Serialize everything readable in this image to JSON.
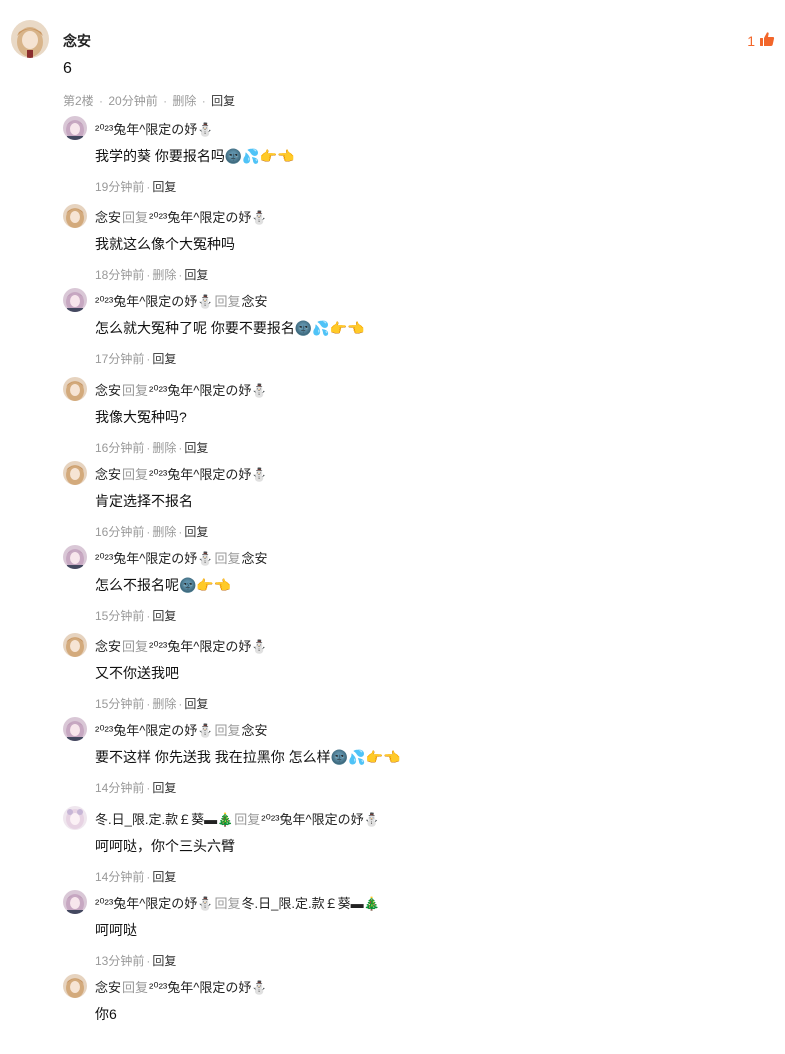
{
  "main_comment": {
    "author": "念安",
    "content": "6",
    "floor": "第2楼",
    "time": "20分钟前",
    "delete_label": "删除",
    "reply_label": "回复",
    "like_count": "1",
    "like_icon": "thumbs-up-icon"
  },
  "reply_word": "回复",
  "delete_word": "删除",
  "sep": "·",
  "replies": [
    {
      "author": "²⁰²³兔年^限定の妤⛄",
      "to": "",
      "text": "我学的葵 你要报名吗🌚💦👉👈",
      "time": "19分钟前",
      "can_delete": false
    },
    {
      "author": "念安",
      "to": "²⁰²³兔年^限定の妤⛄",
      "text": "我就这么像个大冤种吗",
      "time": "18分钟前",
      "can_delete": true
    },
    {
      "author": "²⁰²³兔年^限定の妤⛄",
      "to": "念安",
      "text": "怎么就大冤种了呢 你要不要报名🌚💦👉👈",
      "time": "17分钟前",
      "can_delete": false
    },
    {
      "author": "念安",
      "to": "²⁰²³兔年^限定の妤⛄",
      "text": "我像大冤种吗?",
      "time": "16分钟前",
      "can_delete": true
    },
    {
      "author": "念安",
      "to": "²⁰²³兔年^限定の妤⛄",
      "text": "肯定选择不报名",
      "time": "16分钟前",
      "can_delete": true
    },
    {
      "author": "²⁰²³兔年^限定の妤⛄",
      "to": "念安",
      "text": "怎么不报名呢🌚👉👈",
      "time": "15分钟前",
      "can_delete": false
    },
    {
      "author": "念安",
      "to": "²⁰²³兔年^限定の妤⛄",
      "text": "又不你送我吧",
      "time": "15分钟前",
      "can_delete": true
    },
    {
      "author": "²⁰²³兔年^限定の妤⛄",
      "to": "念安",
      "text": "要不这样 你先送我 我在拉黑你 怎么样🌚💦👉👈",
      "time": "14分钟前",
      "can_delete": false
    },
    {
      "author": "冬.日_限.定.款￡葵▬🎄",
      "to": "²⁰²³兔年^限定の妤⛄",
      "text": "呵呵哒，你个三头六臂",
      "time": "14分钟前",
      "can_delete": false
    },
    {
      "author": "²⁰²³兔年^限定の妤⛄",
      "to": "冬.日_限.定.款￡葵▬🎄",
      "text": "呵呵哒",
      "time": "13分钟前",
      "can_delete": false
    },
    {
      "author": "念安",
      "to": "²⁰²³兔年^限定の妤⛄",
      "text": "你6",
      "time": "",
      "can_delete": false
    }
  ]
}
